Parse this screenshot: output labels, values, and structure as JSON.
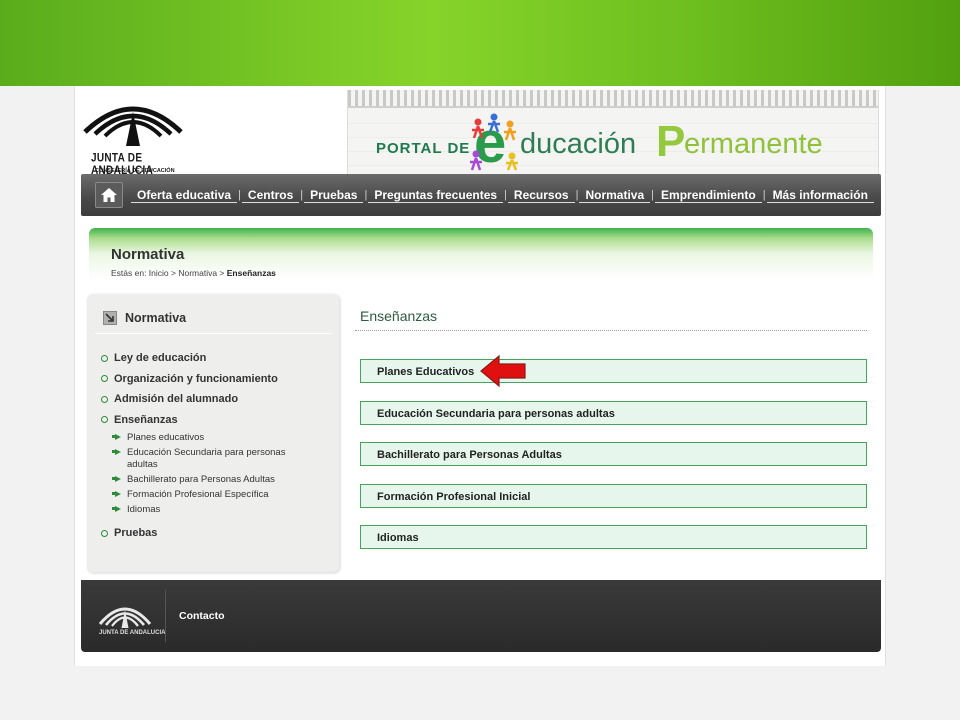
{
  "header": {
    "logo_name": "JUNTA DE ANDALUCIA",
    "logo_sub": "CONSEJERÍA DE EDUCACIÓN",
    "banner_prefix": "PORTAL DE",
    "banner_e": "e",
    "banner_word1": "ducación",
    "banner_p": "P",
    "banner_word2": "ermanente"
  },
  "nav": {
    "home_icon": "home-icon",
    "items": [
      "Oferta educativa",
      "Centros",
      "Pruebas",
      "Preguntas frecuentes",
      "Recursos",
      "Normativa",
      "Emprendimiento",
      "Más información"
    ]
  },
  "page_header": {
    "title": "Normativa",
    "breadcrumb_prefix": "Estás en: Inicio > Normativa >",
    "breadcrumb_current": "Enseñanzas"
  },
  "sidebar": {
    "title": "Normativa",
    "items": [
      {
        "label": "Ley de educación"
      },
      {
        "label": "Organización y funcionamiento"
      },
      {
        "label": "Admisión del alumnado"
      },
      {
        "label": "Enseñanzas"
      },
      {
        "label": "Pruebas"
      }
    ],
    "subitems": [
      "Planes educativos",
      "Educación Secundaria para personas adultas",
      "Bachillerato para Personas Adultas",
      "Formación Profesional Específica",
      "Idiomas"
    ]
  },
  "content": {
    "title": "Enseñanzas",
    "links": [
      "Planes Educativos",
      "Educación Secundaria para personas adultas",
      "Bachillerato para Personas Adultas",
      "Formación Profesional Inicial",
      "Idiomas"
    ]
  },
  "footer": {
    "logo_text": "JUNTA DE ANDALUCIA",
    "contact": "Contacto"
  },
  "colors": {
    "accent_green": "#3fae4a",
    "link_bg": "#e6f6ec",
    "arrow_red": "#e01010"
  }
}
